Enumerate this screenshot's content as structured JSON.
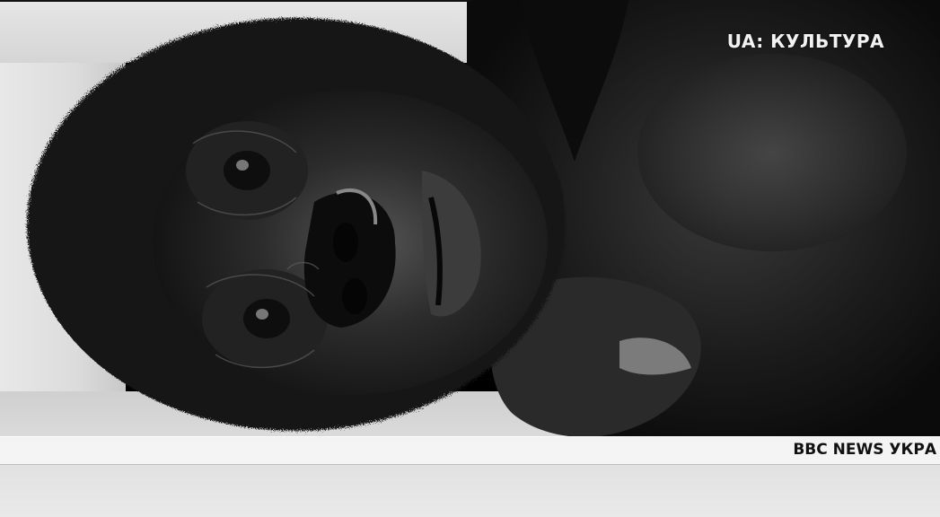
{
  "image": {
    "subject": "gorilla-close-up",
    "tone": "black-and-white"
  },
  "overlay": {
    "channel_logo": "UA: КУЛЬТУРА",
    "ticker_text": "BBC NEWS УКРА"
  },
  "colors": {
    "ticker_background": "#f5f5f5",
    "ticker_text": "#111111",
    "logo_text": "#f2f2f2"
  }
}
